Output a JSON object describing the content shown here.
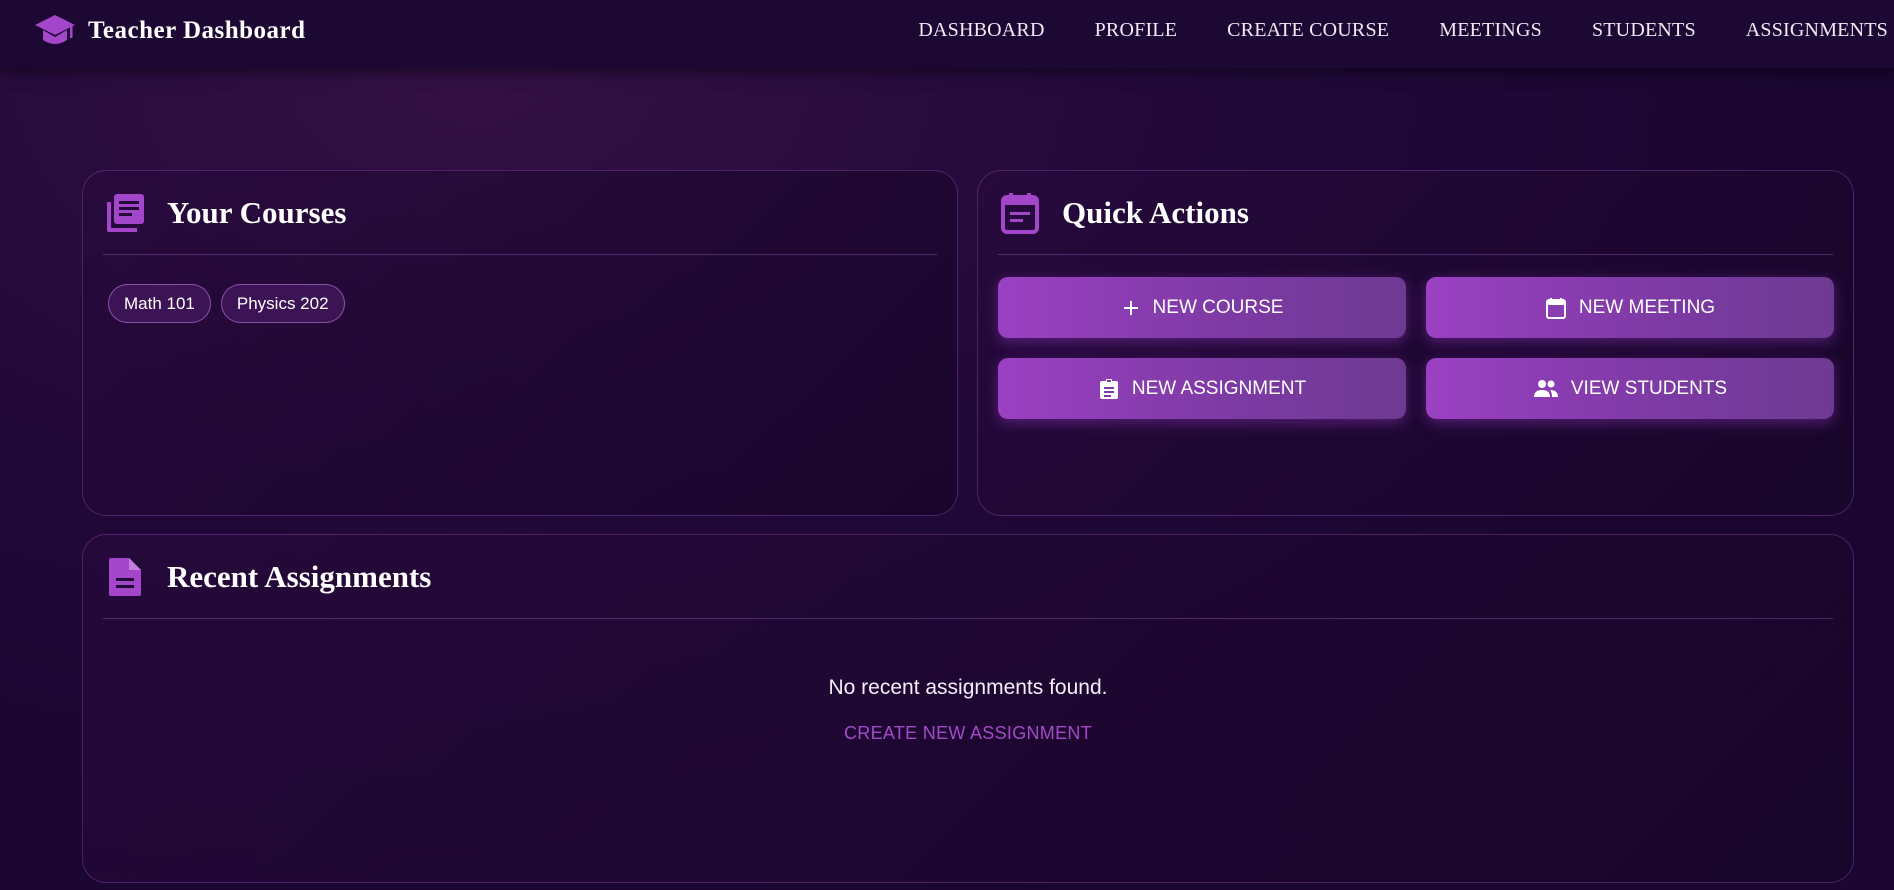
{
  "app": {
    "title": "Teacher Dashboard",
    "icon": "graduation-cap-icon",
    "accent_color": "#a346c9",
    "background_color": "#1f0733"
  },
  "nav": {
    "items": [
      {
        "label": "DASHBOARD"
      },
      {
        "label": "PROFILE"
      },
      {
        "label": "CREATE COURSE"
      },
      {
        "label": "MEETINGS"
      },
      {
        "label": "STUDENTS"
      },
      {
        "label": "ASSIGNMENTS"
      }
    ]
  },
  "courses": {
    "title": "Your Courses",
    "icon": "library-books-icon",
    "items": [
      {
        "label": "Math 101"
      },
      {
        "label": "Physics 202"
      }
    ]
  },
  "quick_actions": {
    "title": "Quick Actions",
    "icon": "event-note-icon",
    "buttons": [
      {
        "label": "NEW COURSE",
        "icon": "plus-icon"
      },
      {
        "label": "NEW MEETING",
        "icon": "calendar-icon"
      },
      {
        "label": "NEW ASSIGNMENT",
        "icon": "assignment-icon"
      },
      {
        "label": "VIEW STUDENTS",
        "icon": "people-icon"
      }
    ]
  },
  "recent_assignments": {
    "title": "Recent Assignments",
    "icon": "document-icon",
    "empty_message": "No recent assignments found.",
    "create_link": "CREATE NEW ASSIGNMENT"
  }
}
